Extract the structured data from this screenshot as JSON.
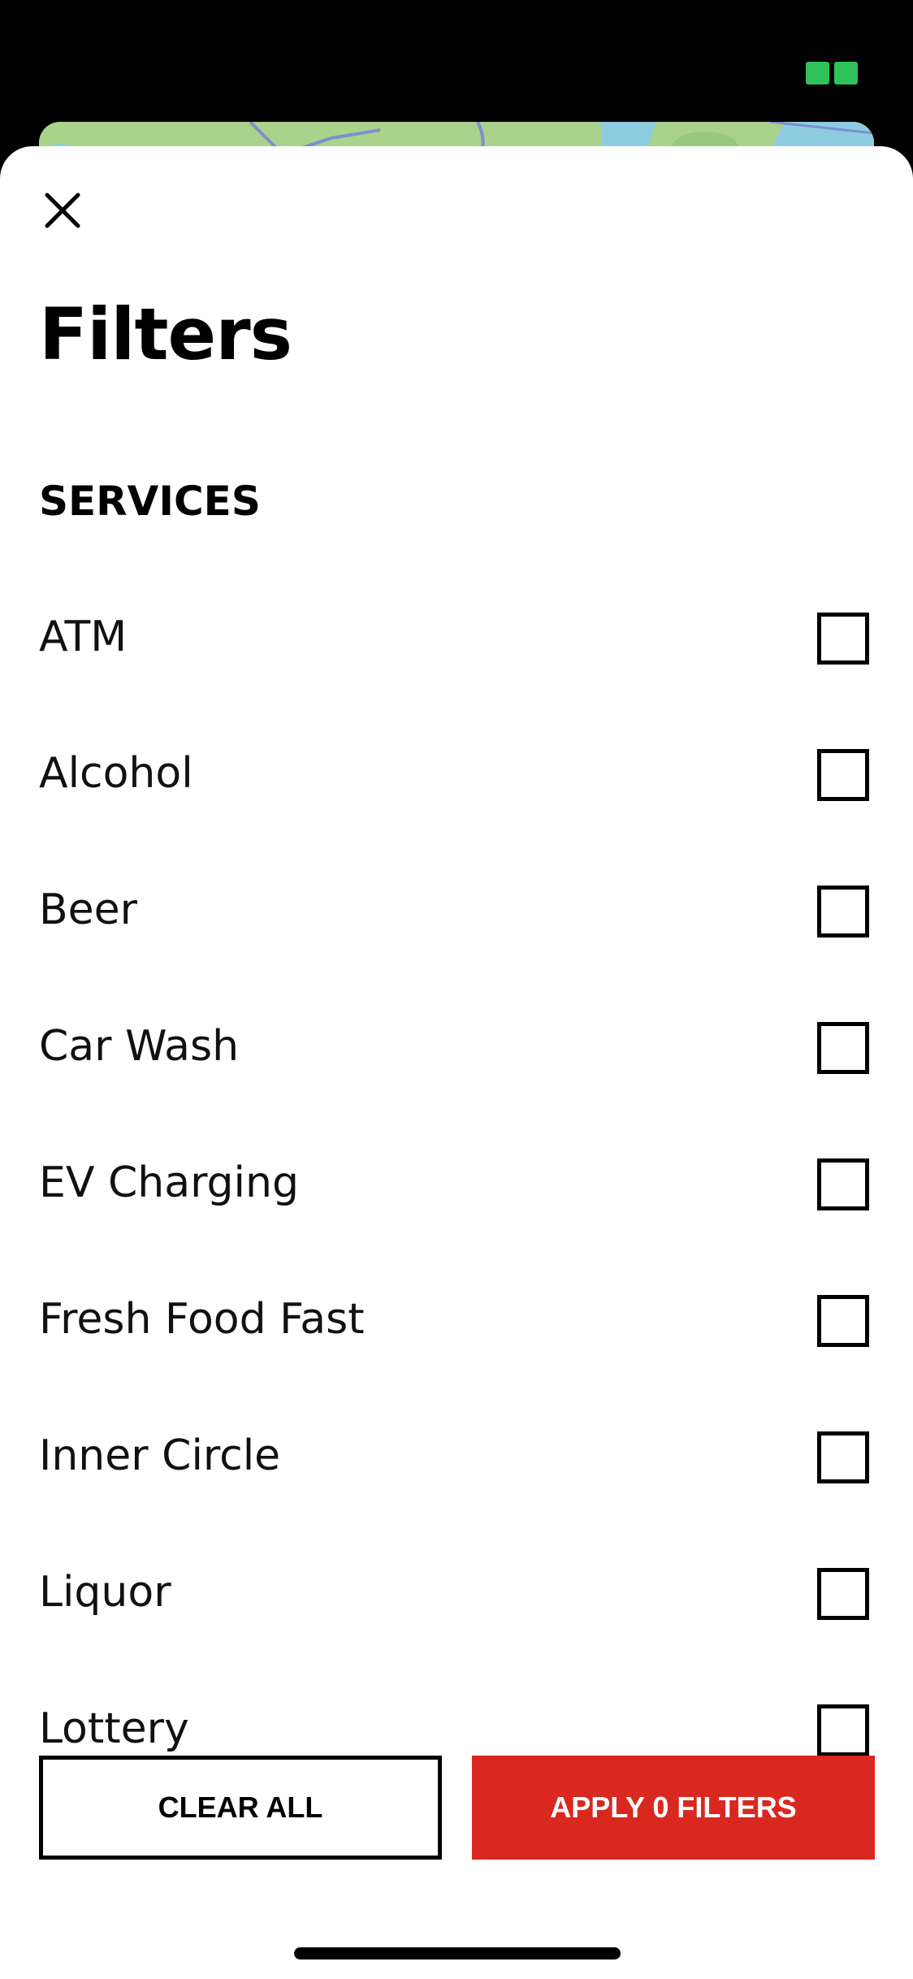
{
  "colors": {
    "accent": "#d9281f",
    "status_icon": "#2fc25b",
    "map_land": "#a9d38a",
    "map_water": "#8ecde0",
    "map_road": "#7d8fd0"
  },
  "icons": {
    "close": "close-icon",
    "status": "status-indicator-icon"
  },
  "sheet": {
    "title": "Filters",
    "section_heading": "SERVICES",
    "options": [
      {
        "label": "ATM",
        "checked": false
      },
      {
        "label": "Alcohol",
        "checked": false
      },
      {
        "label": "Beer",
        "checked": false
      },
      {
        "label": "Car Wash",
        "checked": false
      },
      {
        "label": "EV Charging",
        "checked": false
      },
      {
        "label": "Fresh Food Fast",
        "checked": false
      },
      {
        "label": "Inner Circle",
        "checked": false
      },
      {
        "label": "Liquor",
        "checked": false
      },
      {
        "label": "Lottery",
        "checked": false
      }
    ]
  },
  "footer": {
    "clear_label": "CLEAR ALL",
    "apply_label": "APPLY 0 FILTERS"
  }
}
